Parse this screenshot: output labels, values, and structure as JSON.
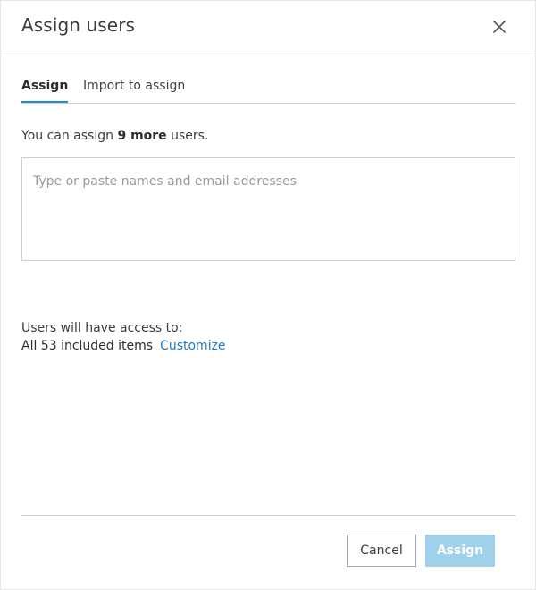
{
  "dialog": {
    "title": "Assign users",
    "close_icon": "close-icon"
  },
  "tabs": [
    {
      "label": "Assign",
      "active": true
    },
    {
      "label": "Import to assign",
      "active": false
    }
  ],
  "info": {
    "prefix": "You can assign ",
    "count": "9 more",
    "suffix": " users."
  },
  "input": {
    "value": "",
    "placeholder": "Type or paste names and email addresses"
  },
  "access": {
    "label": "Users will have access to:",
    "items": "All 53 included items",
    "customize_link": "Customize"
  },
  "footer": {
    "cancel_label": "Cancel",
    "assign_label": "Assign",
    "assign_disabled": true
  },
  "colors": {
    "accent": "#1d8fce",
    "link": "#1e7bbf",
    "assign_disabled_bg": "#9fd0ec"
  }
}
